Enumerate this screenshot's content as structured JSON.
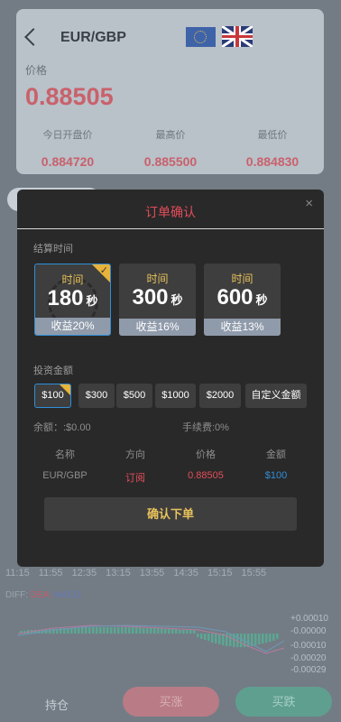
{
  "quote": {
    "pair": "EUR/GBP",
    "price_label": "价格",
    "price": "0.88505",
    "stats": [
      {
        "label": "今日开盘价",
        "value": "0.884720"
      },
      {
        "label": "最高价",
        "value": "0.885500"
      },
      {
        "label": "最低价",
        "value": "0.884830"
      }
    ]
  },
  "chart": {
    "time_ticks": [
      "11:15",
      "11:55",
      "12:35",
      "13:15",
      "13:55",
      "14:35",
      "15:15",
      "15:55"
    ],
    "diff_label": "DIFF:",
    "dea_label": "DEA:",
    "macd_label": "MACD:",
    "y_ticks": [
      "+0.00010",
      "-0.00000",
      "-0.00010",
      "-0.00020",
      "-0.00029"
    ]
  },
  "bottom": {
    "hold": "持仓",
    "buy_up": "买涨",
    "buy_down": "买跌"
  },
  "modal": {
    "title": "订单确认",
    "close": "×",
    "settle_label": "结算时间",
    "time_options": [
      {
        "title": "时间",
        "value": "180",
        "unit": "秒",
        "profit": "收益20%",
        "selected": true
      },
      {
        "title": "时间",
        "value": "300",
        "unit": "秒",
        "profit": "收益16%",
        "selected": false
      },
      {
        "title": "时间",
        "value": "600",
        "unit": "秒",
        "profit": "收益13%",
        "selected": false
      }
    ],
    "amount_label": "投资金额",
    "amounts": [
      "$100",
      "$300",
      "$500",
      "$1000",
      "$2000",
      "自定义金额"
    ],
    "balance": "余额：:$0.00",
    "fee": "手续费:0%",
    "table_headers": [
      "名称",
      "方向",
      "价格",
      "金额"
    ],
    "table_row": [
      "EUR/GBP",
      "订阅",
      "0.88505",
      "$100"
    ],
    "confirm": "确认下单"
  },
  "colors": {
    "accent_red": "#e34d59",
    "gold": "#e8c25b",
    "blue": "#2f8fd9"
  }
}
